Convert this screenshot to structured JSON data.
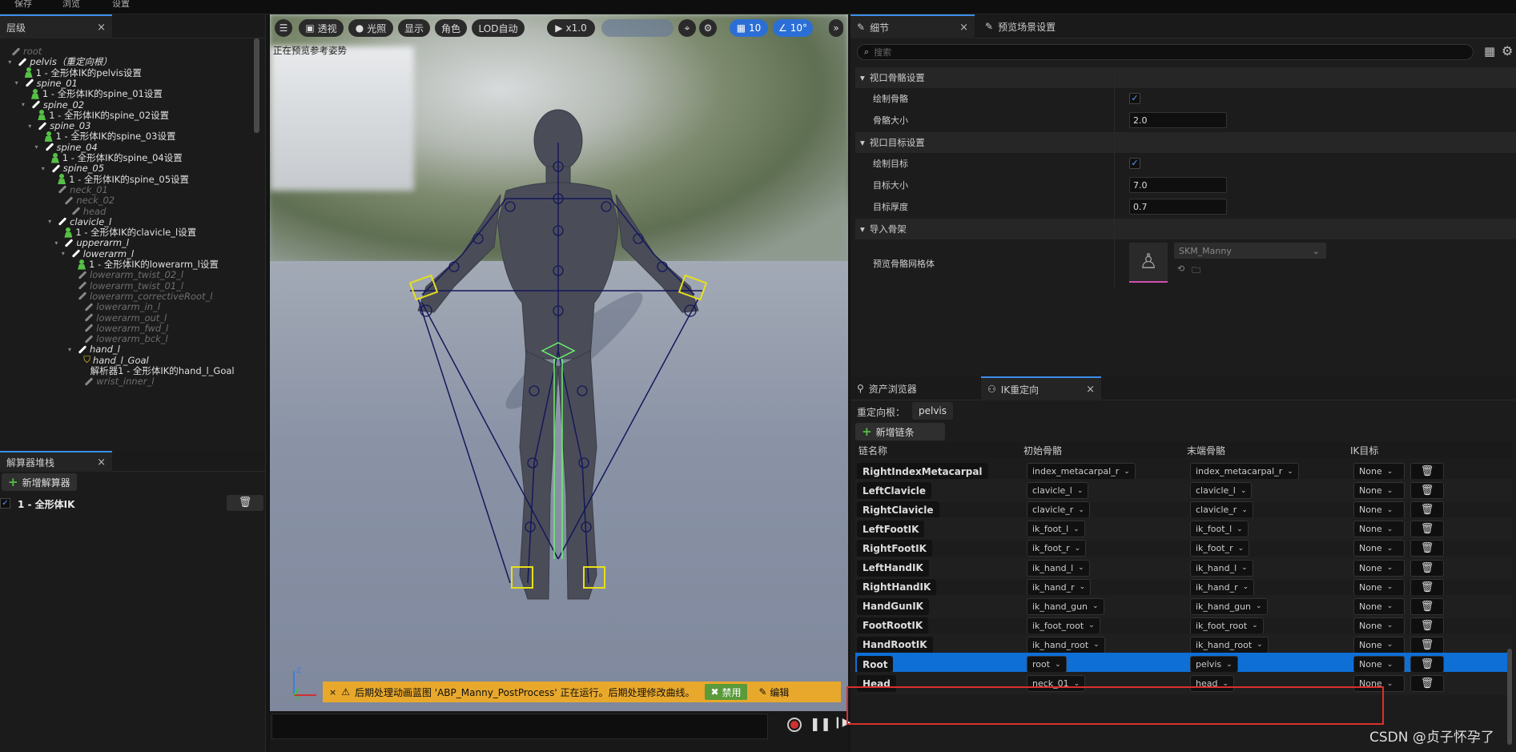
{
  "topstrip": {
    "items": [
      "保存",
      "浏览",
      "设置"
    ]
  },
  "hierarchy": {
    "tab_label": "层级",
    "rows": [
      {
        "label": "root",
        "kind": "bone",
        "dim": true,
        "indent": 0
      },
      {
        "label": "pelvis（重定向根）",
        "kind": "bone",
        "dim": false,
        "indent": 1
      },
      {
        "label": "1 - 全形体IK的pelvis设置",
        "kind": "ik",
        "indent": 2
      },
      {
        "label": "spine_01",
        "kind": "bone",
        "dim": false,
        "indent": 2
      },
      {
        "label": "1 - 全形体IK的spine_01设置",
        "kind": "ik",
        "indent": 3
      },
      {
        "label": "spine_02",
        "kind": "bone",
        "dim": false,
        "indent": 3
      },
      {
        "label": "1 - 全形体IK的spine_02设置",
        "kind": "ik",
        "indent": 4
      },
      {
        "label": "spine_03",
        "kind": "bone",
        "dim": false,
        "indent": 4
      },
      {
        "label": "1 - 全形体IK的spine_03设置",
        "kind": "ik",
        "indent": 5
      },
      {
        "label": "spine_04",
        "kind": "bone",
        "dim": false,
        "indent": 5
      },
      {
        "label": "1 - 全形体IK的spine_04设置",
        "kind": "ik",
        "indent": 6
      },
      {
        "label": "spine_05",
        "kind": "bone",
        "dim": false,
        "indent": 6
      },
      {
        "label": "1 - 全形体IK的spine_05设置",
        "kind": "ik",
        "indent": 7
      },
      {
        "label": "neck_01",
        "kind": "bone",
        "dim": true,
        "indent": 7
      },
      {
        "label": "neck_02",
        "kind": "bone",
        "dim": true,
        "indent": 8
      },
      {
        "label": "head",
        "kind": "bone",
        "dim": true,
        "indent": 9
      },
      {
        "label": "clavicle_l",
        "kind": "bone",
        "dim": false,
        "indent": 7
      },
      {
        "label": "1 - 全形体IK的clavicle_l设置",
        "kind": "ik",
        "indent": 8
      },
      {
        "label": "upperarm_l",
        "kind": "bone",
        "dim": false,
        "indent": 8
      },
      {
        "label": "lowerarm_l",
        "kind": "bone",
        "dim": false,
        "indent": 9
      },
      {
        "label": "1 - 全形体IK的lowerarm_l设置",
        "kind": "ik",
        "indent": 10
      },
      {
        "label": "lowerarm_twist_02_l",
        "kind": "bone",
        "dim": true,
        "indent": 10
      },
      {
        "label": "lowerarm_twist_01_l",
        "kind": "bone",
        "dim": true,
        "indent": 10
      },
      {
        "label": "lowerarm_correctiveRoot_l",
        "kind": "bone",
        "dim": true,
        "indent": 10
      },
      {
        "label": "lowerarm_in_l",
        "kind": "bone",
        "dim": true,
        "indent": 11
      },
      {
        "label": "lowerarm_out_l",
        "kind": "bone",
        "dim": true,
        "indent": 11
      },
      {
        "label": "lowerarm_fwd_l",
        "kind": "bone",
        "dim": true,
        "indent": 11
      },
      {
        "label": "lowerarm_bck_l",
        "kind": "bone",
        "dim": true,
        "indent": 11
      },
      {
        "label": "hand_l",
        "kind": "bone",
        "dim": false,
        "indent": 10
      },
      {
        "label": "hand_l_Goal",
        "kind": "goal",
        "indent": 11
      },
      {
        "label": "解析器1 - 全形体IK的hand_l_Goal",
        "kind": "text",
        "indent": 12
      },
      {
        "label": "wrist_inner_l",
        "kind": "bone",
        "dim": true,
        "indent": 11
      }
    ]
  },
  "solver": {
    "tab_label": "解算器堆栈",
    "add_label": "新增解算器",
    "items": [
      {
        "label": "1 - 全形体IK",
        "checked": true
      }
    ]
  },
  "viewport": {
    "toolbar": {
      "perspective": "透视",
      "lit": "光照",
      "show": "显示",
      "character": "角色",
      "lod": "LOD自动",
      "speed": "x1.0",
      "grid_size": "10",
      "angle": "10°"
    },
    "preview_label": "正在预览参考姿势",
    "toast": {
      "message": "后期处理动画蓝图 'ABP_Manny_PostProcess' 正在运行。后期处理修改曲线。",
      "disable": "禁用",
      "edit": "编辑"
    }
  },
  "details": {
    "tabs": [
      "细节",
      "预览场景设置"
    ],
    "search_placeholder": "搜索",
    "sections": [
      {
        "title": "视口骨骼设置",
        "props": [
          {
            "label": "绘制骨骼",
            "type": "check",
            "value": "✓"
          },
          {
            "label": "骨骼大小",
            "type": "number",
            "value": "2.0"
          }
        ]
      },
      {
        "title": "视口目标设置",
        "props": [
          {
            "label": "绘制目标",
            "type": "check",
            "value": "✓"
          },
          {
            "label": "目标大小",
            "type": "number",
            "value": "7.0"
          },
          {
            "label": "目标厚度",
            "type": "number",
            "value": "0.7"
          }
        ]
      },
      {
        "title": "导入骨架",
        "props": [
          {
            "label": "预览骨骼网格体",
            "type": "asset",
            "value": "SKM_Manny"
          }
        ]
      }
    ]
  },
  "retarget": {
    "tabs": [
      "资产浏览器",
      "IK重定向"
    ],
    "root_label": "重定向根：",
    "root_value": "pelvis",
    "add_chain_label": "新增链条",
    "columns": [
      "链名称",
      "初始骨骼",
      "末端骨骼",
      "IK目标"
    ],
    "rows": [
      {
        "chain": "RightIndexMetacarpal",
        "start": "index_metacarpal_r",
        "end": "index_metacarpal_r",
        "ik": "None",
        "selected": false
      },
      {
        "chain": "LeftClavicle",
        "start": "clavicle_l",
        "end": "clavicle_l",
        "ik": "None",
        "selected": false
      },
      {
        "chain": "RightClavicle",
        "start": "clavicle_r",
        "end": "clavicle_r",
        "ik": "None",
        "selected": false
      },
      {
        "chain": "LeftFootIK",
        "start": "ik_foot_l",
        "end": "ik_foot_l",
        "ik": "None",
        "selected": false
      },
      {
        "chain": "RightFootIK",
        "start": "ik_foot_r",
        "end": "ik_foot_r",
        "ik": "None",
        "selected": false
      },
      {
        "chain": "LeftHandIK",
        "start": "ik_hand_l",
        "end": "ik_hand_l",
        "ik": "None",
        "selected": false
      },
      {
        "chain": "RightHandIK",
        "start": "ik_hand_r",
        "end": "ik_hand_r",
        "ik": "None",
        "selected": false
      },
      {
        "chain": "HandGunIK",
        "start": "ik_hand_gun",
        "end": "ik_hand_gun",
        "ik": "None",
        "selected": false
      },
      {
        "chain": "FootRootIK",
        "start": "ik_foot_root",
        "end": "ik_foot_root",
        "ik": "None",
        "selected": false
      },
      {
        "chain": "HandRootIK",
        "start": "ik_hand_root",
        "end": "ik_hand_root",
        "ik": "None",
        "selected": false
      },
      {
        "chain": "Root",
        "start": "root",
        "end": "pelvis",
        "ik": "None",
        "selected": true
      },
      {
        "chain": "Head",
        "start": "neck_01",
        "end": "head",
        "ik": "None",
        "selected": false
      }
    ]
  },
  "watermark": "CSDN @贞子怀孕了",
  "colors": {
    "accent": "#0e6fd6",
    "highlight": "#d9302b",
    "ik_green": "#56c046",
    "toast": "#e8a82c"
  }
}
